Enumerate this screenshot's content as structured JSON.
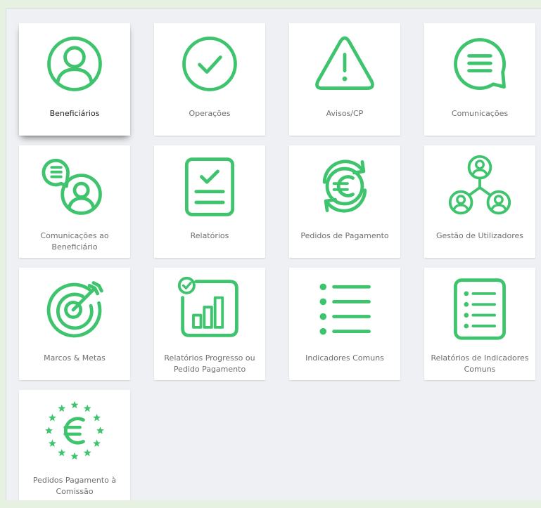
{
  "accent_color": "#3ec46d",
  "tiles": [
    {
      "label": "Beneficiários",
      "icon": "user-circle-icon"
    },
    {
      "label": "Operações",
      "icon": "check-circle-icon"
    },
    {
      "label": "Avisos/CP",
      "icon": "warning-triangle-icon"
    },
    {
      "label": "Comunicações",
      "icon": "chat-bubble-icon"
    },
    {
      "label": "Comunicações ao Beneficiário",
      "icon": "user-message-icon"
    },
    {
      "label": "Relatórios",
      "icon": "report-check-icon"
    },
    {
      "label": "Pedidos de Pagamento",
      "icon": "euro-refresh-icon"
    },
    {
      "label": "Gestão de Utilizadores",
      "icon": "user-network-icon"
    },
    {
      "label": "Marcos & Metas",
      "icon": "target-arrow-icon"
    },
    {
      "label": "Relatórios Progresso ou Pedido Pagamento",
      "icon": "progress-chart-icon"
    },
    {
      "label": "Indicadores Comuns",
      "icon": "bullet-list-icon"
    },
    {
      "label": "Relatórios de Indicadores Comuns",
      "icon": "list-document-icon"
    },
    {
      "label": "Pedidos Pagamento à Comissão",
      "icon": "euro-stars-icon"
    }
  ]
}
